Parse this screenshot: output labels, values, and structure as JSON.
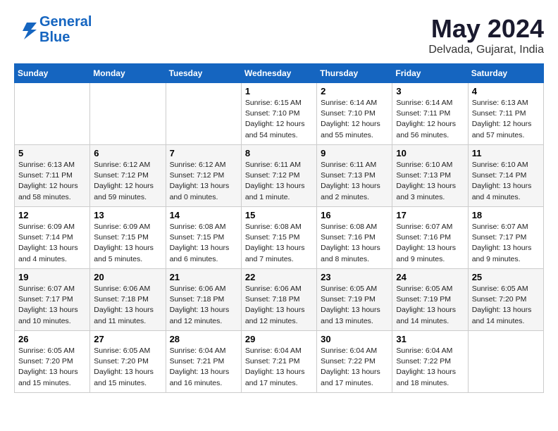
{
  "header": {
    "logo_line1": "General",
    "logo_line2": "Blue",
    "month_year": "May 2024",
    "location": "Delvada, Gujarat, India"
  },
  "weekdays": [
    "Sunday",
    "Monday",
    "Tuesday",
    "Wednesday",
    "Thursday",
    "Friday",
    "Saturday"
  ],
  "weeks": [
    [
      {
        "day": "",
        "detail": ""
      },
      {
        "day": "",
        "detail": ""
      },
      {
        "day": "",
        "detail": ""
      },
      {
        "day": "1",
        "detail": "Sunrise: 6:15 AM\nSunset: 7:10 PM\nDaylight: 12 hours\nand 54 minutes."
      },
      {
        "day": "2",
        "detail": "Sunrise: 6:14 AM\nSunset: 7:10 PM\nDaylight: 12 hours\nand 55 minutes."
      },
      {
        "day": "3",
        "detail": "Sunrise: 6:14 AM\nSunset: 7:11 PM\nDaylight: 12 hours\nand 56 minutes."
      },
      {
        "day": "4",
        "detail": "Sunrise: 6:13 AM\nSunset: 7:11 PM\nDaylight: 12 hours\nand 57 minutes."
      }
    ],
    [
      {
        "day": "5",
        "detail": "Sunrise: 6:13 AM\nSunset: 7:11 PM\nDaylight: 12 hours\nand 58 minutes."
      },
      {
        "day": "6",
        "detail": "Sunrise: 6:12 AM\nSunset: 7:12 PM\nDaylight: 12 hours\nand 59 minutes."
      },
      {
        "day": "7",
        "detail": "Sunrise: 6:12 AM\nSunset: 7:12 PM\nDaylight: 13 hours\nand 0 minutes."
      },
      {
        "day": "8",
        "detail": "Sunrise: 6:11 AM\nSunset: 7:12 PM\nDaylight: 13 hours\nand 1 minute."
      },
      {
        "day": "9",
        "detail": "Sunrise: 6:11 AM\nSunset: 7:13 PM\nDaylight: 13 hours\nand 2 minutes."
      },
      {
        "day": "10",
        "detail": "Sunrise: 6:10 AM\nSunset: 7:13 PM\nDaylight: 13 hours\nand 3 minutes."
      },
      {
        "day": "11",
        "detail": "Sunrise: 6:10 AM\nSunset: 7:14 PM\nDaylight: 13 hours\nand 4 minutes."
      }
    ],
    [
      {
        "day": "12",
        "detail": "Sunrise: 6:09 AM\nSunset: 7:14 PM\nDaylight: 13 hours\nand 4 minutes."
      },
      {
        "day": "13",
        "detail": "Sunrise: 6:09 AM\nSunset: 7:15 PM\nDaylight: 13 hours\nand 5 minutes."
      },
      {
        "day": "14",
        "detail": "Sunrise: 6:08 AM\nSunset: 7:15 PM\nDaylight: 13 hours\nand 6 minutes."
      },
      {
        "day": "15",
        "detail": "Sunrise: 6:08 AM\nSunset: 7:15 PM\nDaylight: 13 hours\nand 7 minutes."
      },
      {
        "day": "16",
        "detail": "Sunrise: 6:08 AM\nSunset: 7:16 PM\nDaylight: 13 hours\nand 8 minutes."
      },
      {
        "day": "17",
        "detail": "Sunrise: 6:07 AM\nSunset: 7:16 PM\nDaylight: 13 hours\nand 9 minutes."
      },
      {
        "day": "18",
        "detail": "Sunrise: 6:07 AM\nSunset: 7:17 PM\nDaylight: 13 hours\nand 9 minutes."
      }
    ],
    [
      {
        "day": "19",
        "detail": "Sunrise: 6:07 AM\nSunset: 7:17 PM\nDaylight: 13 hours\nand 10 minutes."
      },
      {
        "day": "20",
        "detail": "Sunrise: 6:06 AM\nSunset: 7:18 PM\nDaylight: 13 hours\nand 11 minutes."
      },
      {
        "day": "21",
        "detail": "Sunrise: 6:06 AM\nSunset: 7:18 PM\nDaylight: 13 hours\nand 12 minutes."
      },
      {
        "day": "22",
        "detail": "Sunrise: 6:06 AM\nSunset: 7:18 PM\nDaylight: 13 hours\nand 12 minutes."
      },
      {
        "day": "23",
        "detail": "Sunrise: 6:05 AM\nSunset: 7:19 PM\nDaylight: 13 hours\nand 13 minutes."
      },
      {
        "day": "24",
        "detail": "Sunrise: 6:05 AM\nSunset: 7:19 PM\nDaylight: 13 hours\nand 14 minutes."
      },
      {
        "day": "25",
        "detail": "Sunrise: 6:05 AM\nSunset: 7:20 PM\nDaylight: 13 hours\nand 14 minutes."
      }
    ],
    [
      {
        "day": "26",
        "detail": "Sunrise: 6:05 AM\nSunset: 7:20 PM\nDaylight: 13 hours\nand 15 minutes."
      },
      {
        "day": "27",
        "detail": "Sunrise: 6:05 AM\nSunset: 7:20 PM\nDaylight: 13 hours\nand 15 minutes."
      },
      {
        "day": "28",
        "detail": "Sunrise: 6:04 AM\nSunset: 7:21 PM\nDaylight: 13 hours\nand 16 minutes."
      },
      {
        "day": "29",
        "detail": "Sunrise: 6:04 AM\nSunset: 7:21 PM\nDaylight: 13 hours\nand 17 minutes."
      },
      {
        "day": "30",
        "detail": "Sunrise: 6:04 AM\nSunset: 7:22 PM\nDaylight: 13 hours\nand 17 minutes."
      },
      {
        "day": "31",
        "detail": "Sunrise: 6:04 AM\nSunset: 7:22 PM\nDaylight: 13 hours\nand 18 minutes."
      },
      {
        "day": "",
        "detail": ""
      }
    ]
  ]
}
